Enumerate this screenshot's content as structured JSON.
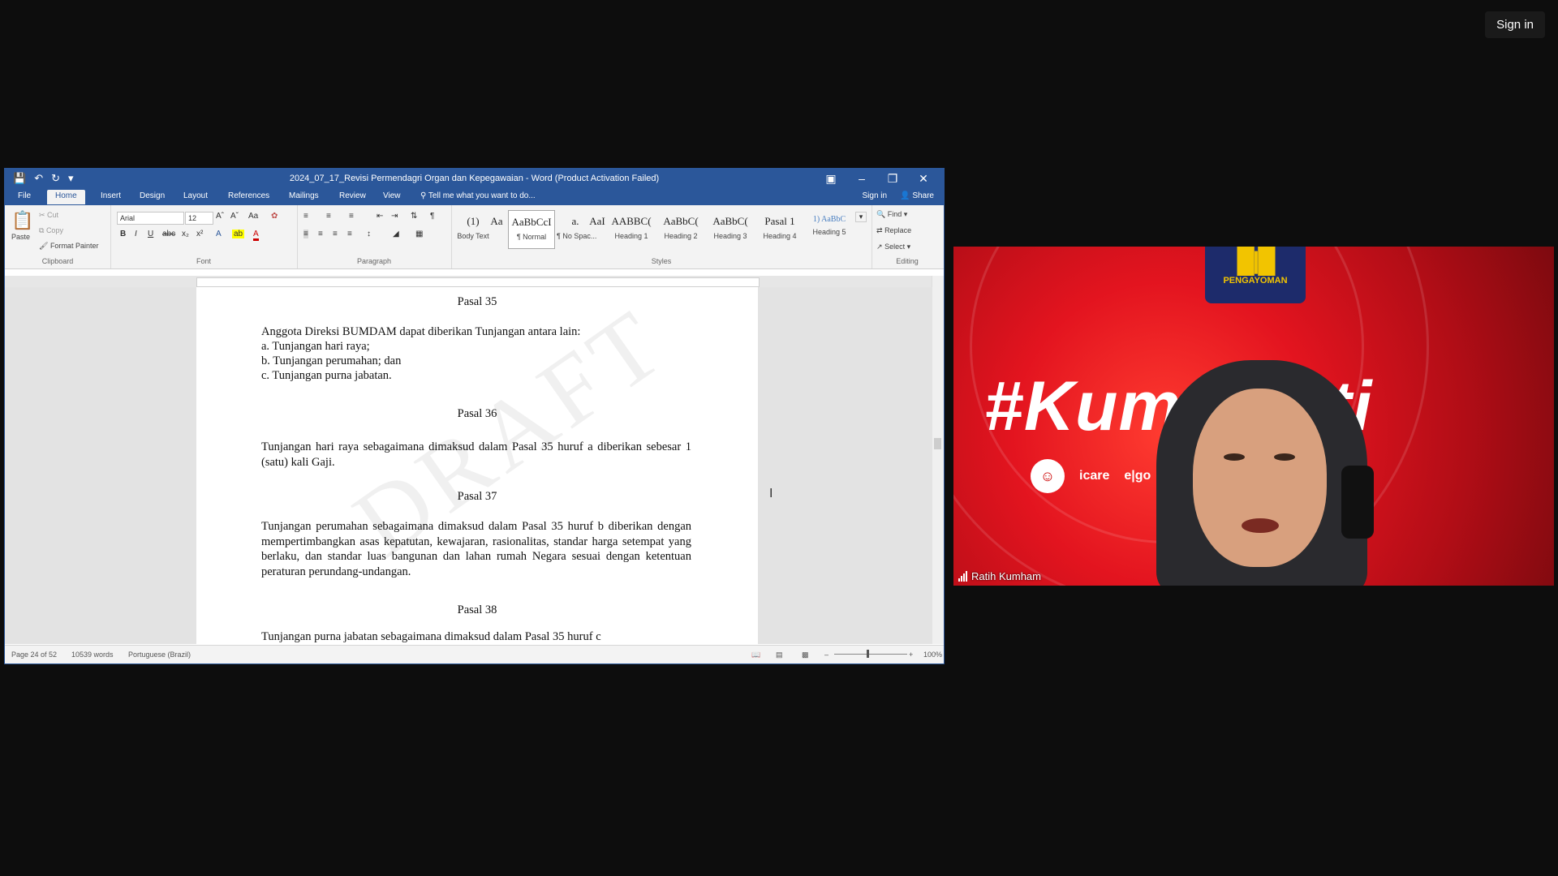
{
  "top": {
    "sign_in": "Sign in"
  },
  "word": {
    "title": "2024_07_17_Revisi Permendagri Organ dan Kepegawaian - Word (Product Activation Failed)",
    "tabs": [
      "File",
      "Home",
      "Insert",
      "Design",
      "Layout",
      "References",
      "Mailings",
      "Review",
      "View"
    ],
    "tell_me": "Tell me what you want to do...",
    "sign_in": "Sign in",
    "share": "Share",
    "clipboard": {
      "paste": "Paste",
      "cut": "Cut",
      "copy": "Copy",
      "format_painter": "Format Painter",
      "label": "Clipboard"
    },
    "font": {
      "name": "Arial",
      "size": "12",
      "label": "Font"
    },
    "paragraph_label": "Paragraph",
    "styles": [
      {
        "sample": "(1)",
        "name": "Body Text"
      },
      {
        "sample": "Aa",
        "name": ""
      },
      {
        "sample": "AaBbCcI",
        "name": "¶ Normal"
      },
      {
        "sample": "a.",
        "name": "¶ No Spac..."
      },
      {
        "sample": "AaI",
        "name": ""
      },
      {
        "sample": "AABBC(",
        "name": "Heading 1"
      },
      {
        "sample": "AaBbC(",
        "name": "Heading 2"
      },
      {
        "sample": "AaBbC(",
        "name": "Heading 3"
      },
      {
        "sample": "Pasal 1",
        "name": "Heading 4"
      },
      {
        "sample": "1) AaBbC",
        "name": "Heading 5"
      }
    ],
    "styles_label": "Styles",
    "editing": {
      "find": "Find",
      "replace": "Replace",
      "select": "Select",
      "label": "Editing"
    },
    "document": {
      "watermark": "DRAFT",
      "p35_head": "Pasal 35",
      "p35_intro": "Anggota Direksi BUMDAM dapat diberikan Tunjangan antara lain:",
      "p35_a": "a.   Tunjangan hari raya;",
      "p35_b": "b.   Tunjangan perumahan; dan",
      "p35_c": "c.   Tunjangan purna jabatan.",
      "p36_head": "Pasal 36",
      "p36_text": "Tunjangan hari raya sebagaimana dimaksud dalam Pasal 35 huruf a diberikan sebesar 1 (satu) kali Gaji.",
      "p37_head": "Pasal 37",
      "p37_text": "Tunjangan perumahan sebagaimana dimaksud dalam Pasal 35 huruf b diberikan dengan mempertimbangkan asas kepatutan, kewajaran, rasionalitas, standar harga setempat yang berlaku, dan standar luas bangunan dan lahan rumah Negara sesuai dengan ketentuan peraturan perundang-undangan.",
      "p38_head": "Pasal 38",
      "p38_text": "Tunjangan purna jabatan sebagaimana dimaksud dalam Pasal 35 huruf c"
    },
    "status": {
      "page": "Page 24 of 52",
      "words": "10539 words",
      "language": "Portuguese (Brazil)",
      "zoom": "100%"
    }
  },
  "video": {
    "logo_text": "PENGAYOMAN",
    "hashtag": "#Kum      Pasti",
    "brands": [
      "icare",
      "e|go"
    ],
    "participant_name": "Ratih Kumham"
  }
}
